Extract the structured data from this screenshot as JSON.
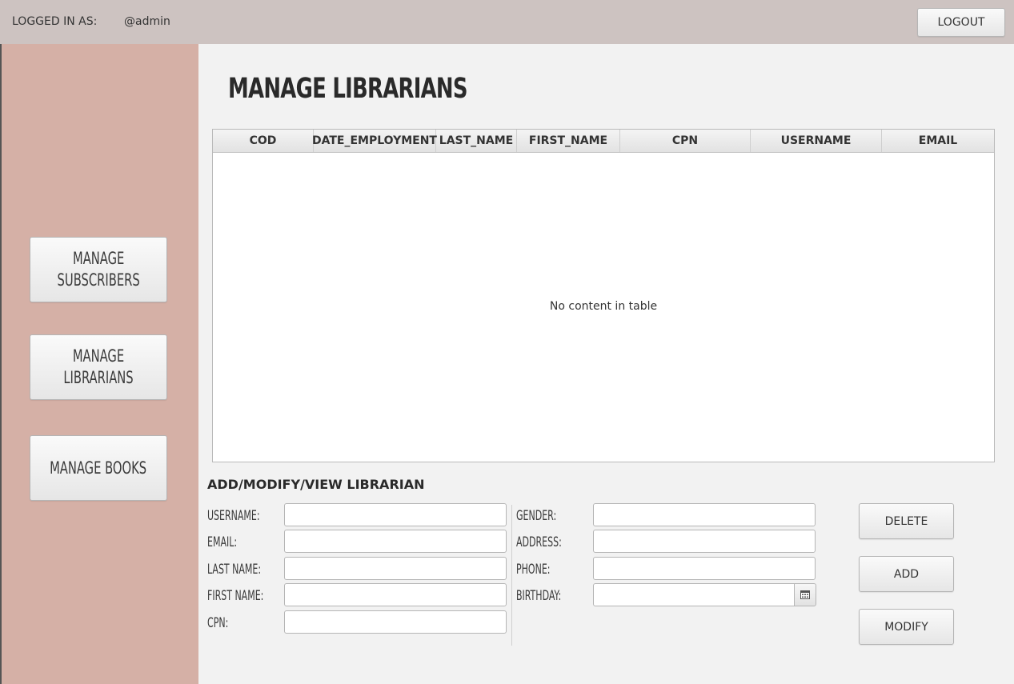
{
  "header": {
    "logged_label": "LOGGED IN AS:",
    "username": "@admin",
    "logout_label": "LOGOUT"
  },
  "sidebar": {
    "items": [
      {
        "line1": "MANAGE",
        "line2": "SUBSCRIBERS"
      },
      {
        "line1": "MANAGE",
        "line2": "LIBRARIANS"
      },
      {
        "line1": "MANAGE BOOKS"
      }
    ]
  },
  "main": {
    "title": "MANAGE LIBRARIANS",
    "table": {
      "columns": [
        "COD",
        "DATE_EMPLOYMENT",
        "LAST_NAME",
        "FIRST_NAME",
        "CPN",
        "USERNAME",
        "EMAIL"
      ],
      "empty_message": "No content in table"
    },
    "form": {
      "title": "ADD/MODIFY/VIEW LIBRARIAN",
      "left_fields": [
        "USERNAME:",
        "EMAIL:",
        "LAST NAME:",
        "FIRST NAME:",
        "CPN:"
      ],
      "right_fields": [
        "GENDER:",
        "ADDRESS:",
        "PHONE:",
        "BIRTHDAY:"
      ],
      "values": {
        "username": "",
        "email": "",
        "last_name": "",
        "first_name": "",
        "cpn": "",
        "gender": "",
        "address": "",
        "phone": "",
        "birthday": ""
      },
      "calendar_icon": "calendar-icon",
      "buttons": {
        "delete": "DELETE",
        "add": "ADD",
        "modify": "MODIFY"
      }
    }
  },
  "colors": {
    "topbar": "#cdc3c1",
    "sidebar": "#d5b0a6",
    "main": "#f2f2f2"
  }
}
